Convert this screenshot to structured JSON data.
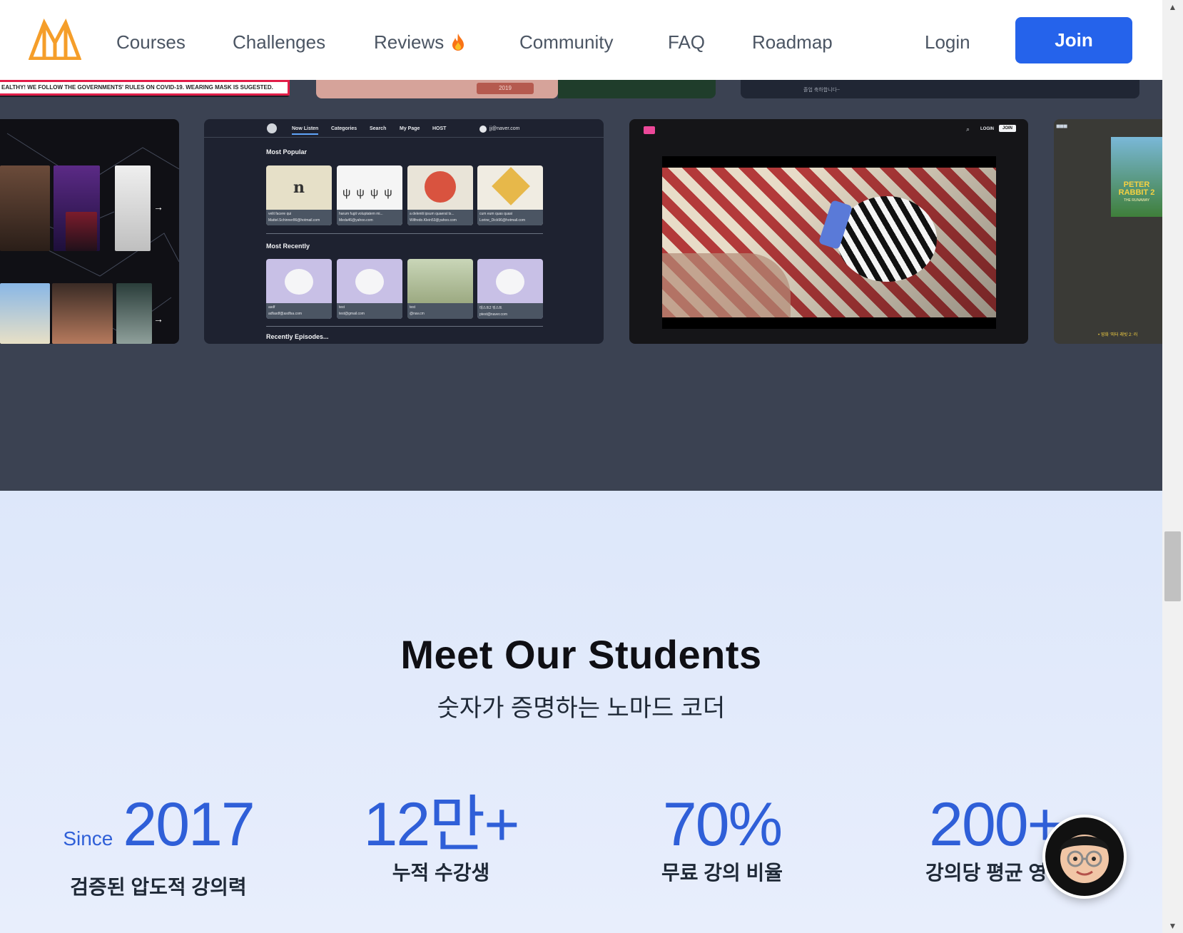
{
  "header": {
    "nav": [
      {
        "label": "Courses"
      },
      {
        "label": "Challenges"
      },
      {
        "label": "Reviews"
      },
      {
        "label": "Community"
      },
      {
        "label": "FAQ"
      },
      {
        "label": "Roadmap"
      }
    ],
    "login_label": "Login",
    "join_label": "Join",
    "brand_color": "#2563eb",
    "logo_color": "#f59e2a"
  },
  "showcase": {
    "banner_text": "EALTHY! WE FOLLOW THE GOVERNMENTS' RULES ON COVID-19. WEARING MASK IS SUGESTED.",
    "year_tag": "2019",
    "strip_caption": "졸업 축하합니다~",
    "podcast_app": {
      "nav": [
        "Now Listen",
        "Categories",
        "Search",
        "My Page",
        "HOST"
      ],
      "user_email": "jj@naver.com",
      "sections": [
        "Most Popular",
        "Most Recently",
        "Recently Episodes..."
      ],
      "popular_cards": [
        {
          "title": "velit facere qui",
          "sub": "Mattel.Schinner86@hotmail.com"
        },
        {
          "title": "harum fugit voluptatem mi...",
          "sub": "Meda46@yahoo.com"
        },
        {
          "title": "a deleniti ipsum quaerat ts...",
          "sub": "Wilfredo.Klein53@yahoo.com"
        },
        {
          "title": "cum eum quas quasi",
          "sub": "Lorine_Dick96@hotmail.com"
        }
      ],
      "recent_cards": [
        {
          "title": "asdf",
          "sub": "adfasdf@asdfsa.com"
        },
        {
          "title": "test",
          "sub": "test@gmail.com"
        },
        {
          "title": "test",
          "sub": "@nav.cm"
        },
        {
          "title": "테스트2 뭐스트",
          "sub": "ptest@naver.com"
        }
      ]
    },
    "video_app": {
      "login_label": "LOGIN",
      "join_label": "JOIN"
    },
    "rabbit_thumb": {
      "poster_title": "PETER RABBIT 2",
      "poster_sub": "THE RUNAWAY",
      "caption": "• 영화 '피터 래빗 2: 러"
    }
  },
  "students": {
    "title": "Meet Our Students",
    "subtitle": "숫자가 증명하는 노마드 코더",
    "stats": [
      {
        "prefix": "Since",
        "value": "2017",
        "caption": "검증된 압도적 강의력"
      },
      {
        "prefix": "",
        "value": "12만+",
        "caption": "누적 수강생"
      },
      {
        "prefix": "",
        "value": "70%",
        "caption": "무료 강의 비율"
      },
      {
        "prefix": "",
        "value": "200+",
        "caption": "강의당 평균 영상"
      }
    ],
    "accent_color": "#2f5fd8"
  }
}
